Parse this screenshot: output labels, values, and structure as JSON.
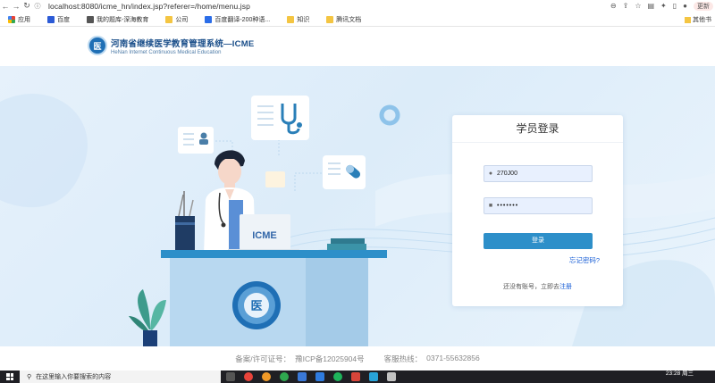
{
  "browser": {
    "url": "localhost:8080/icme_hn/index.jsp?referer=/home/menu.jsp",
    "update_label": "更新",
    "bookmarks": [
      {
        "label": "应用",
        "icon": "apps-icon"
      },
      {
        "label": "百度",
        "icon": "baidu-icon"
      },
      {
        "label": "我的题库-深海教育",
        "icon": "cube-icon"
      },
      {
        "label": "公司",
        "icon": "folder-icon"
      },
      {
        "label": "百度翻译-200种语...",
        "icon": "translate-icon"
      },
      {
        "label": "知识",
        "icon": "folder-icon"
      },
      {
        "label": "腾讯文档",
        "icon": "tencent-docs-icon"
      }
    ],
    "other_bookmarks": "其他书"
  },
  "site": {
    "logo_mark": "医",
    "title": "河南省继续医学教育管理系统—ICME",
    "subtitle": "HeNan Internet Continuous Medical Education"
  },
  "illustration": {
    "laptop_label": "ICME"
  },
  "login": {
    "title": "学员登录",
    "username_value": "270J00",
    "password_value": "•••••••",
    "submit_label": "登录",
    "forgot_label": "忘记密码?",
    "no_account_text": "还没有账号，立即去",
    "register_label": "注册"
  },
  "footer": {
    "license_label": "备案/许可证号：",
    "license_value": "豫ICP备12025904号",
    "hotline_label": "客服热线：",
    "hotline_value": "0371-55632856"
  },
  "taskbar": {
    "search_placeholder": "在这里输入你要搜索的内容",
    "time": "23:28 周三",
    "date": ""
  },
  "colors": {
    "accent": "#2d8fc9",
    "brand": "#1b4f8a",
    "link": "#1a5fd6",
    "hero_bg": "#e2eff9"
  }
}
